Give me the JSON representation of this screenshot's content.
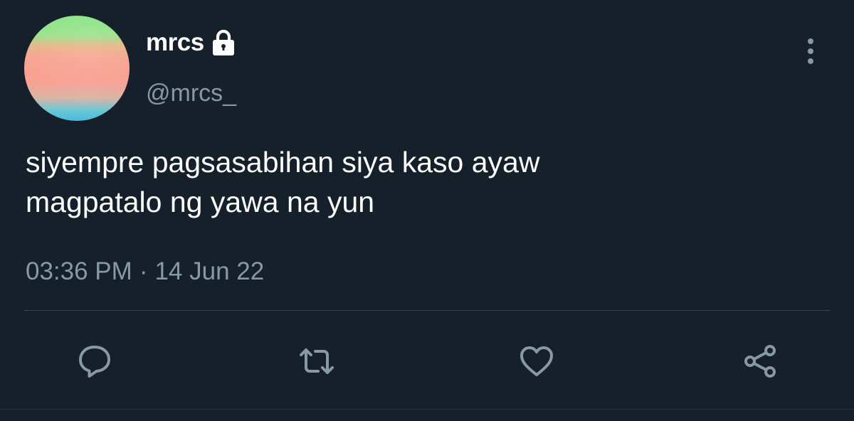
{
  "user": {
    "display_name": "mrcs",
    "handle": "@mrcs_",
    "protected_icon": "lock-icon",
    "avatar": "gradient-avatar"
  },
  "tweet": {
    "text_line1": "siyempre pagsasabihan siya kaso ayaw",
    "text_line2": "magpatalo ng yawa na yun",
    "time": "03:36 PM",
    "separator": "·",
    "date": "14 Jun 22"
  },
  "actions": {
    "reply_icon": "reply-icon",
    "retweet_icon": "retweet-icon",
    "like_icon": "heart-icon",
    "share_icon": "share-icon",
    "more_icon": "more-vertical-icon"
  },
  "colors": {
    "background": "#15202b",
    "primary_text": "#ffffff",
    "secondary_text": "#8899a6",
    "divider": "#38444d"
  }
}
